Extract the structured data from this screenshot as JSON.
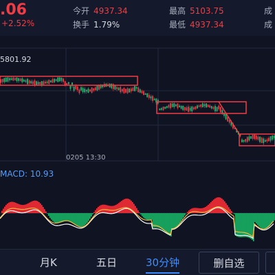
{
  "header": {
    "price": ".06",
    "change": "+2.52%",
    "open_label": "今开",
    "open_value": "4937.34",
    "turnover_label": "换手",
    "turnover_value": "1.79%",
    "high_label": "最高",
    "high_value": "5103.75",
    "low_label": "最低",
    "low_value": "4937.34",
    "vol_label_1": "成",
    "vol_label_2": "成"
  },
  "chart": {
    "top_price": "5801.92",
    "time_label": "0205  13:30"
  },
  "macd": {
    "label": "MACD: 10.93"
  },
  "bottom": {
    "tab_month": "月K",
    "tab_fiveday": "五日",
    "tab_30min": "30分钟",
    "delete_button": "删自选"
  },
  "colors": {
    "up": "#f23c45",
    "down": "#2bb673",
    "accent": "#3f8cff"
  }
}
